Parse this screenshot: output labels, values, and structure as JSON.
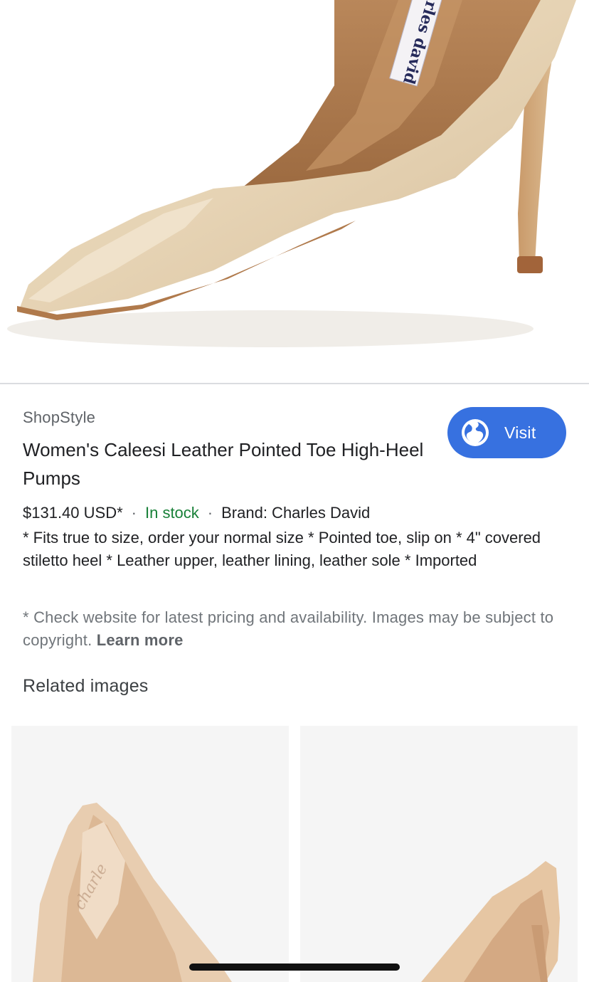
{
  "hero": {
    "image": "beige-pointed-toe-pump-photo",
    "insole_label_text": "rles david"
  },
  "result": {
    "source": "ShopStyle",
    "title": "Women's Caleesi Leather Pointed Toe High-Heel Pumps",
    "visit_button": {
      "label": "Visit",
      "icon": "globe-icon",
      "color": "#3771e0"
    },
    "price": "$131.40 USD*",
    "separator": "·",
    "stock_status": "In stock",
    "stock_color": "#188038",
    "brand": "Brand: Charles David",
    "description": "* Fits true to size, order your normal size * Pointed toe, slip on * 4\" covered stiletto heel * Leather upper, leather lining, leather sole * Imported",
    "disclaimer": "* Check website for latest pricing and availability. Images may be subject to copyright.",
    "learn_more": "Learn more"
  },
  "related": {
    "heading": "Related images",
    "items": [
      {
        "image": "nude-pump-side-view-photo"
      },
      {
        "image": "nude-pump-heel-view-photo"
      }
    ]
  }
}
